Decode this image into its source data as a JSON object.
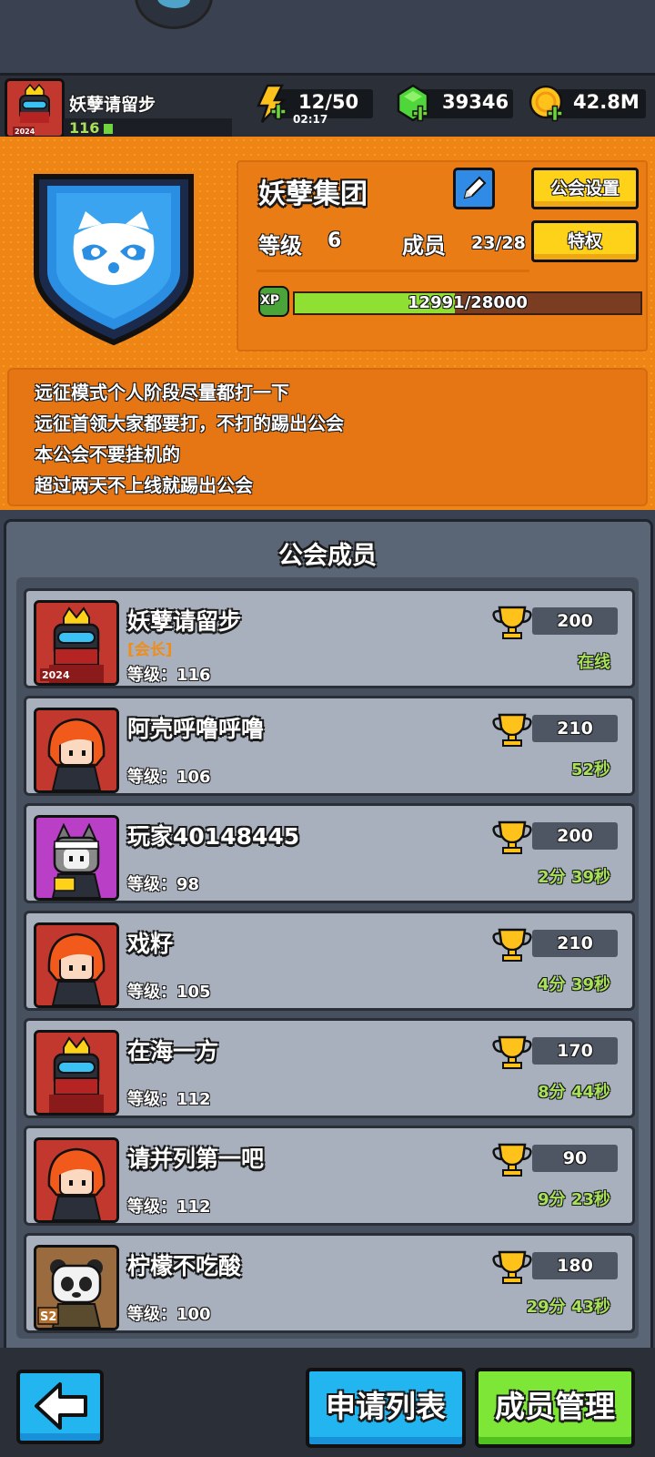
{
  "header": {
    "player_name": "妖孽请留步",
    "player_level": "116",
    "avatar_badge": "2024",
    "energy": "12/50",
    "energy_timer": "02:17",
    "gems": "39346",
    "gold": "42.8M"
  },
  "guild": {
    "name": "妖孽集团",
    "settings_label": "公会设置",
    "privilege_label": "特权",
    "level_label": "等级",
    "level_value": "6",
    "members_label": "成员",
    "members_value": "23/28",
    "xp_label": "XP",
    "xp_value": "12991/28000",
    "xp_fraction": 0.464
  },
  "notice": {
    "lines": [
      "远征模式个人阶段尽量都打一下",
      "远征首领大家都要打，不打的踢出公会",
      "本公会不要挂机的",
      "超过两天不上线就踢出公会"
    ]
  },
  "members": {
    "title": "公会成员",
    "level_prefix": "等级：",
    "list": [
      {
        "name": "妖孽请留步",
        "role": "[会长]",
        "level": "116",
        "score": "200",
        "status": "在线",
        "avatar": "ninja",
        "badge": "2024"
      },
      {
        "name": "阿壳呼噜呼噜",
        "role": "",
        "level": "106",
        "score": "210",
        "status": "52秒",
        "avatar": "redhair"
      },
      {
        "name": "玩家40148445",
        "role": "",
        "level": "98",
        "score": "200",
        "status": "2分 39秒",
        "avatar": "cat"
      },
      {
        "name": "戏籽",
        "role": "",
        "level": "105",
        "score": "210",
        "status": "4分 39秒",
        "avatar": "redhair"
      },
      {
        "name": "在海一方",
        "role": "",
        "level": "112",
        "score": "170",
        "status": "8分 44秒",
        "avatar": "ninja"
      },
      {
        "name": "请并列第一吧",
        "role": "",
        "level": "112",
        "score": "90",
        "status": "9分 23秒",
        "avatar": "redhair"
      },
      {
        "name": "柠檬不吃酸",
        "role": "",
        "level": "100",
        "score": "180",
        "status": "29分 43秒",
        "avatar": "panda",
        "badge": "S2"
      }
    ]
  },
  "footer": {
    "apply_list_label": "申请列表",
    "member_manage_label": "成员管理"
  },
  "colors": {
    "accent_orange": "#ee8514",
    "online_green": "#a8e25a",
    "button_yellow": "#ffd21a",
    "button_blue": "#22b5f0",
    "button_green": "#7de637"
  }
}
